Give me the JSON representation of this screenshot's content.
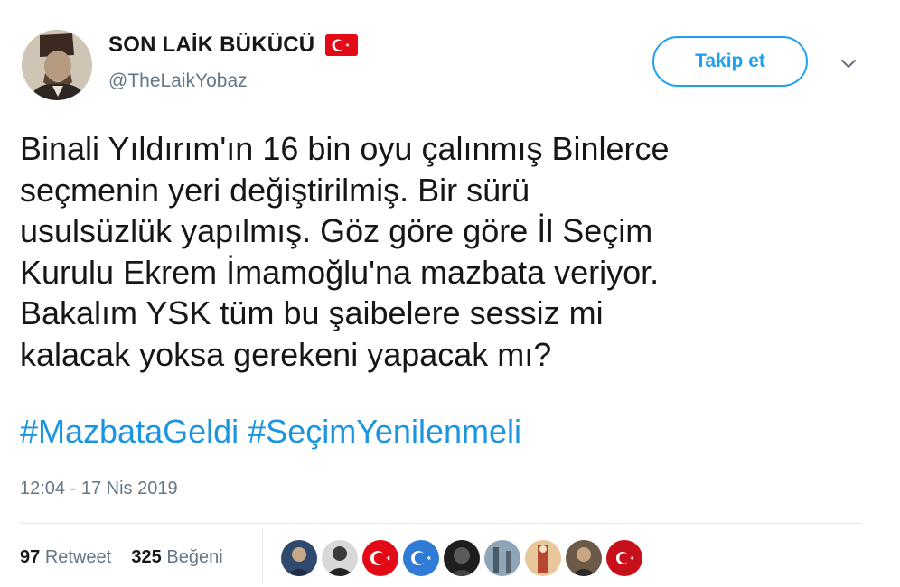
{
  "author": {
    "display_name": "SON LAİK BÜKÜCÜ",
    "handle": "@TheLaikYobaz"
  },
  "follow_button_label": "Takip et",
  "tweet": {
    "lines": [
      "Binali Yıldırım'ın 16 bin oyu çalınmış Binlerce",
      "seçmenin yeri değiştirilmiş. Bir sürü",
      "usulsüzlük yapılmış. Göz göre göre İl Seçim",
      "Kurulu Ekrem İmamoğlu'na mazbata veriyor.",
      "Bakalım YSK tüm bu şaibelere sessiz mi",
      "kalacak yoksa gerekeni yapacak mı?"
    ],
    "hashtags": [
      "#MazbataGeldi",
      "#SeçimYenilenmeli"
    ]
  },
  "timestamp": "12:04 - 17 Nis 2019",
  "stats": {
    "retweet_count": "97",
    "retweet_label": "Retweet",
    "like_count": "325",
    "like_label": "Beğeni"
  },
  "likers": [
    {
      "icon": "user-avatar"
    },
    {
      "icon": "user-avatar"
    },
    {
      "icon": "turkish-flag"
    },
    {
      "icon": "east-turkestan-flag"
    },
    {
      "icon": "user-avatar"
    },
    {
      "icon": "user-avatar"
    },
    {
      "icon": "user-avatar"
    },
    {
      "icon": "user-avatar"
    },
    {
      "icon": "turkish-flag"
    }
  ],
  "colors": {
    "accent": "#1da1f2",
    "hashtag": "#1b95e0",
    "muted": "#657786",
    "flag_red": "#e30a17"
  }
}
